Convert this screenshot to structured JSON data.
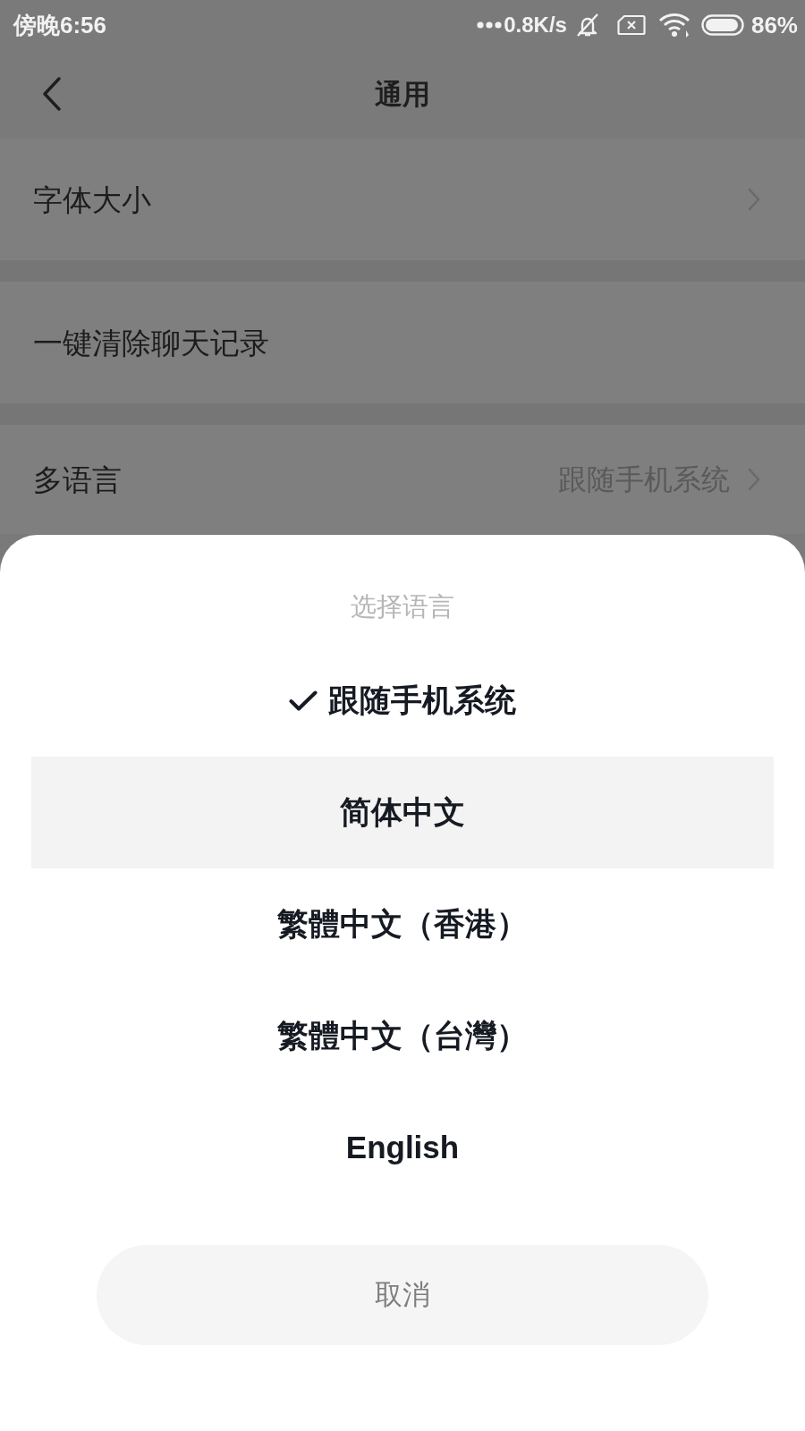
{
  "status_bar": {
    "time": "傍晚6:56",
    "network_speed": "0.8K/s",
    "battery": "86%"
  },
  "header": {
    "title": "通用"
  },
  "settings": [
    {
      "label": "字体大小",
      "arrow": true
    },
    {
      "label": "一键清除聊天记录",
      "arrow": false
    },
    {
      "label": "多语言",
      "value": "跟随手机系统",
      "arrow": true
    }
  ],
  "language_sheet": {
    "title": "选择语言",
    "options": [
      {
        "label": "跟随手机系统",
        "selected": true,
        "pressed": false
      },
      {
        "label": "简体中文",
        "selected": false,
        "pressed": true
      },
      {
        "label": "繁體中文（香港）",
        "selected": false,
        "pressed": false
      },
      {
        "label": "繁體中文（台灣）",
        "selected": false,
        "pressed": false
      },
      {
        "label": "English",
        "selected": false,
        "pressed": false
      }
    ],
    "cancel": "取消"
  }
}
